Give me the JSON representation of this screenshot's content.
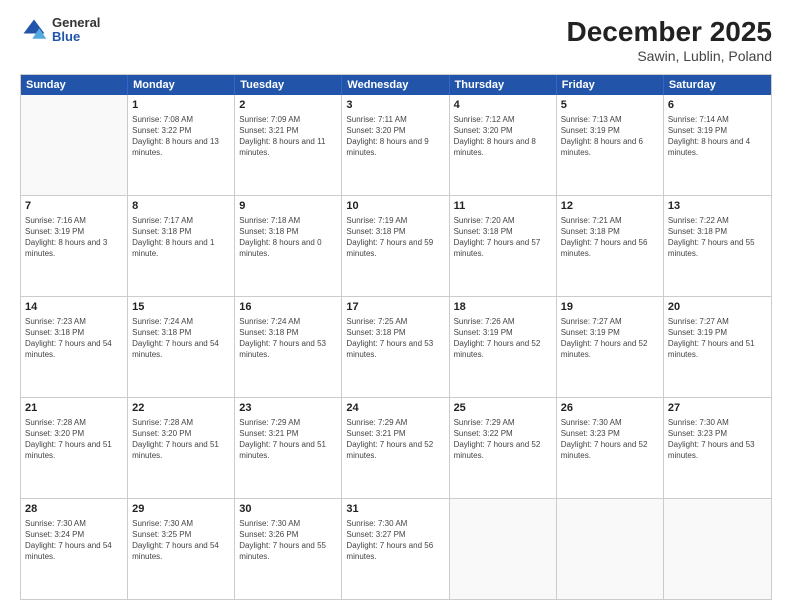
{
  "logo": {
    "general": "General",
    "blue": "Blue"
  },
  "title": "December 2025",
  "subtitle": "Sawin, Lublin, Poland",
  "header_days": [
    "Sunday",
    "Monday",
    "Tuesday",
    "Wednesday",
    "Thursday",
    "Friday",
    "Saturday"
  ],
  "weeks": [
    [
      {
        "day": "",
        "sunrise": "",
        "sunset": "",
        "daylight": ""
      },
      {
        "day": "1",
        "sunrise": "Sunrise: 7:08 AM",
        "sunset": "Sunset: 3:22 PM",
        "daylight": "Daylight: 8 hours and 13 minutes."
      },
      {
        "day": "2",
        "sunrise": "Sunrise: 7:09 AM",
        "sunset": "Sunset: 3:21 PM",
        "daylight": "Daylight: 8 hours and 11 minutes."
      },
      {
        "day": "3",
        "sunrise": "Sunrise: 7:11 AM",
        "sunset": "Sunset: 3:20 PM",
        "daylight": "Daylight: 8 hours and 9 minutes."
      },
      {
        "day": "4",
        "sunrise": "Sunrise: 7:12 AM",
        "sunset": "Sunset: 3:20 PM",
        "daylight": "Daylight: 8 hours and 8 minutes."
      },
      {
        "day": "5",
        "sunrise": "Sunrise: 7:13 AM",
        "sunset": "Sunset: 3:19 PM",
        "daylight": "Daylight: 8 hours and 6 minutes."
      },
      {
        "day": "6",
        "sunrise": "Sunrise: 7:14 AM",
        "sunset": "Sunset: 3:19 PM",
        "daylight": "Daylight: 8 hours and 4 minutes."
      }
    ],
    [
      {
        "day": "7",
        "sunrise": "Sunrise: 7:16 AM",
        "sunset": "Sunset: 3:19 PM",
        "daylight": "Daylight: 8 hours and 3 minutes."
      },
      {
        "day": "8",
        "sunrise": "Sunrise: 7:17 AM",
        "sunset": "Sunset: 3:18 PM",
        "daylight": "Daylight: 8 hours and 1 minute."
      },
      {
        "day": "9",
        "sunrise": "Sunrise: 7:18 AM",
        "sunset": "Sunset: 3:18 PM",
        "daylight": "Daylight: 8 hours and 0 minutes."
      },
      {
        "day": "10",
        "sunrise": "Sunrise: 7:19 AM",
        "sunset": "Sunset: 3:18 PM",
        "daylight": "Daylight: 7 hours and 59 minutes."
      },
      {
        "day": "11",
        "sunrise": "Sunrise: 7:20 AM",
        "sunset": "Sunset: 3:18 PM",
        "daylight": "Daylight: 7 hours and 57 minutes."
      },
      {
        "day": "12",
        "sunrise": "Sunrise: 7:21 AM",
        "sunset": "Sunset: 3:18 PM",
        "daylight": "Daylight: 7 hours and 56 minutes."
      },
      {
        "day": "13",
        "sunrise": "Sunrise: 7:22 AM",
        "sunset": "Sunset: 3:18 PM",
        "daylight": "Daylight: 7 hours and 55 minutes."
      }
    ],
    [
      {
        "day": "14",
        "sunrise": "Sunrise: 7:23 AM",
        "sunset": "Sunset: 3:18 PM",
        "daylight": "Daylight: 7 hours and 54 minutes."
      },
      {
        "day": "15",
        "sunrise": "Sunrise: 7:24 AM",
        "sunset": "Sunset: 3:18 PM",
        "daylight": "Daylight: 7 hours and 54 minutes."
      },
      {
        "day": "16",
        "sunrise": "Sunrise: 7:24 AM",
        "sunset": "Sunset: 3:18 PM",
        "daylight": "Daylight: 7 hours and 53 minutes."
      },
      {
        "day": "17",
        "sunrise": "Sunrise: 7:25 AM",
        "sunset": "Sunset: 3:18 PM",
        "daylight": "Daylight: 7 hours and 53 minutes."
      },
      {
        "day": "18",
        "sunrise": "Sunrise: 7:26 AM",
        "sunset": "Sunset: 3:19 PM",
        "daylight": "Daylight: 7 hours and 52 minutes."
      },
      {
        "day": "19",
        "sunrise": "Sunrise: 7:27 AM",
        "sunset": "Sunset: 3:19 PM",
        "daylight": "Daylight: 7 hours and 52 minutes."
      },
      {
        "day": "20",
        "sunrise": "Sunrise: 7:27 AM",
        "sunset": "Sunset: 3:19 PM",
        "daylight": "Daylight: 7 hours and 51 minutes."
      }
    ],
    [
      {
        "day": "21",
        "sunrise": "Sunrise: 7:28 AM",
        "sunset": "Sunset: 3:20 PM",
        "daylight": "Daylight: 7 hours and 51 minutes."
      },
      {
        "day": "22",
        "sunrise": "Sunrise: 7:28 AM",
        "sunset": "Sunset: 3:20 PM",
        "daylight": "Daylight: 7 hours and 51 minutes."
      },
      {
        "day": "23",
        "sunrise": "Sunrise: 7:29 AM",
        "sunset": "Sunset: 3:21 PM",
        "daylight": "Daylight: 7 hours and 51 minutes."
      },
      {
        "day": "24",
        "sunrise": "Sunrise: 7:29 AM",
        "sunset": "Sunset: 3:21 PM",
        "daylight": "Daylight: 7 hours and 52 minutes."
      },
      {
        "day": "25",
        "sunrise": "Sunrise: 7:29 AM",
        "sunset": "Sunset: 3:22 PM",
        "daylight": "Daylight: 7 hours and 52 minutes."
      },
      {
        "day": "26",
        "sunrise": "Sunrise: 7:30 AM",
        "sunset": "Sunset: 3:23 PM",
        "daylight": "Daylight: 7 hours and 52 minutes."
      },
      {
        "day": "27",
        "sunrise": "Sunrise: 7:30 AM",
        "sunset": "Sunset: 3:23 PM",
        "daylight": "Daylight: 7 hours and 53 minutes."
      }
    ],
    [
      {
        "day": "28",
        "sunrise": "Sunrise: 7:30 AM",
        "sunset": "Sunset: 3:24 PM",
        "daylight": "Daylight: 7 hours and 54 minutes."
      },
      {
        "day": "29",
        "sunrise": "Sunrise: 7:30 AM",
        "sunset": "Sunset: 3:25 PM",
        "daylight": "Daylight: 7 hours and 54 minutes."
      },
      {
        "day": "30",
        "sunrise": "Sunrise: 7:30 AM",
        "sunset": "Sunset: 3:26 PM",
        "daylight": "Daylight: 7 hours and 55 minutes."
      },
      {
        "day": "31",
        "sunrise": "Sunrise: 7:30 AM",
        "sunset": "Sunset: 3:27 PM",
        "daylight": "Daylight: 7 hours and 56 minutes."
      },
      {
        "day": "",
        "sunrise": "",
        "sunset": "",
        "daylight": ""
      },
      {
        "day": "",
        "sunrise": "",
        "sunset": "",
        "daylight": ""
      },
      {
        "day": "",
        "sunrise": "",
        "sunset": "",
        "daylight": ""
      }
    ]
  ]
}
